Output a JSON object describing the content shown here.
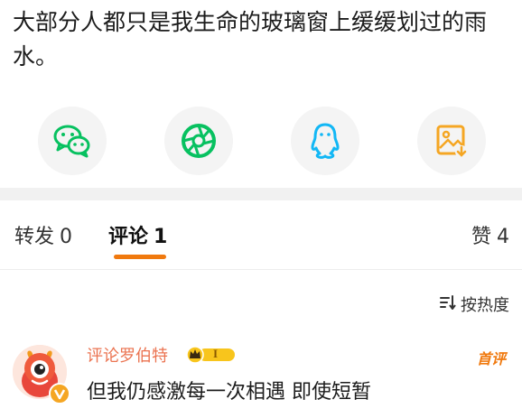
{
  "post": {
    "text": "大部分人都只是我生命的玻璃窗上缓缓划过的雨水。"
  },
  "share": {
    "items": [
      {
        "icon": "wechat-icon",
        "color": "#07c160"
      },
      {
        "icon": "moments-icon",
        "color": "#07c160"
      },
      {
        "icon": "qq-icon",
        "color": "#12b7f5"
      },
      {
        "icon": "save-image-icon",
        "color": "#f5a623"
      }
    ]
  },
  "tabs": {
    "repost_label": "转发",
    "repost_count": "0",
    "comment_label": "评论",
    "comment_count": "1",
    "like_label": "赞",
    "like_count": "4",
    "indicator_color": "#f0790e"
  },
  "sort": {
    "label": "按热度"
  },
  "comments": [
    {
      "username": "评论罗伯特",
      "badge_level": "I",
      "badge_tag": "首评",
      "text": "但我仍感激每一次相遇 即使短暂",
      "username_color": "#eb7350"
    }
  ]
}
